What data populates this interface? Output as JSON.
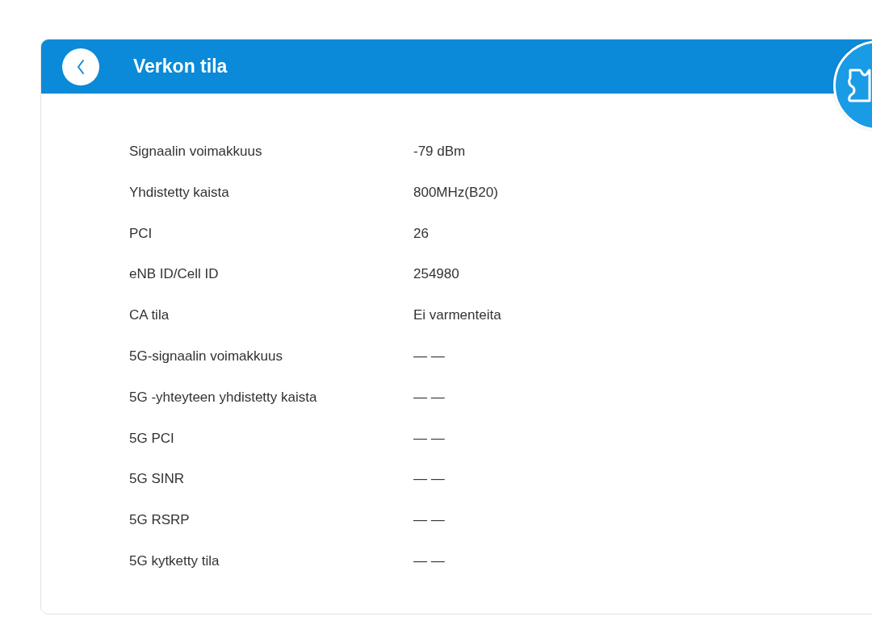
{
  "header": {
    "title": "Verkon tila"
  },
  "rows": [
    {
      "label": "Signaalin voimakkuus",
      "value": "-79 dBm"
    },
    {
      "label": "Yhdistetty kaista",
      "value": "800MHz(B20)"
    },
    {
      "label": "PCI",
      "value": "26"
    },
    {
      "label": "eNB ID/Cell ID",
      "value": "254980"
    },
    {
      "label": "CA tila",
      "value": "Ei varmenteita"
    },
    {
      "label": "5G-signaalin voimakkuus",
      "value": "— —"
    },
    {
      "label": "5G -yhteyteen yhdistetty kaista",
      "value": "— —"
    },
    {
      "label": "5G PCI",
      "value": "— —"
    },
    {
      "label": "5G SINR",
      "value": "— —"
    },
    {
      "label": "5G RSRP",
      "value": "— —"
    },
    {
      "label": "5G kytketty tila",
      "value": "— —"
    }
  ]
}
